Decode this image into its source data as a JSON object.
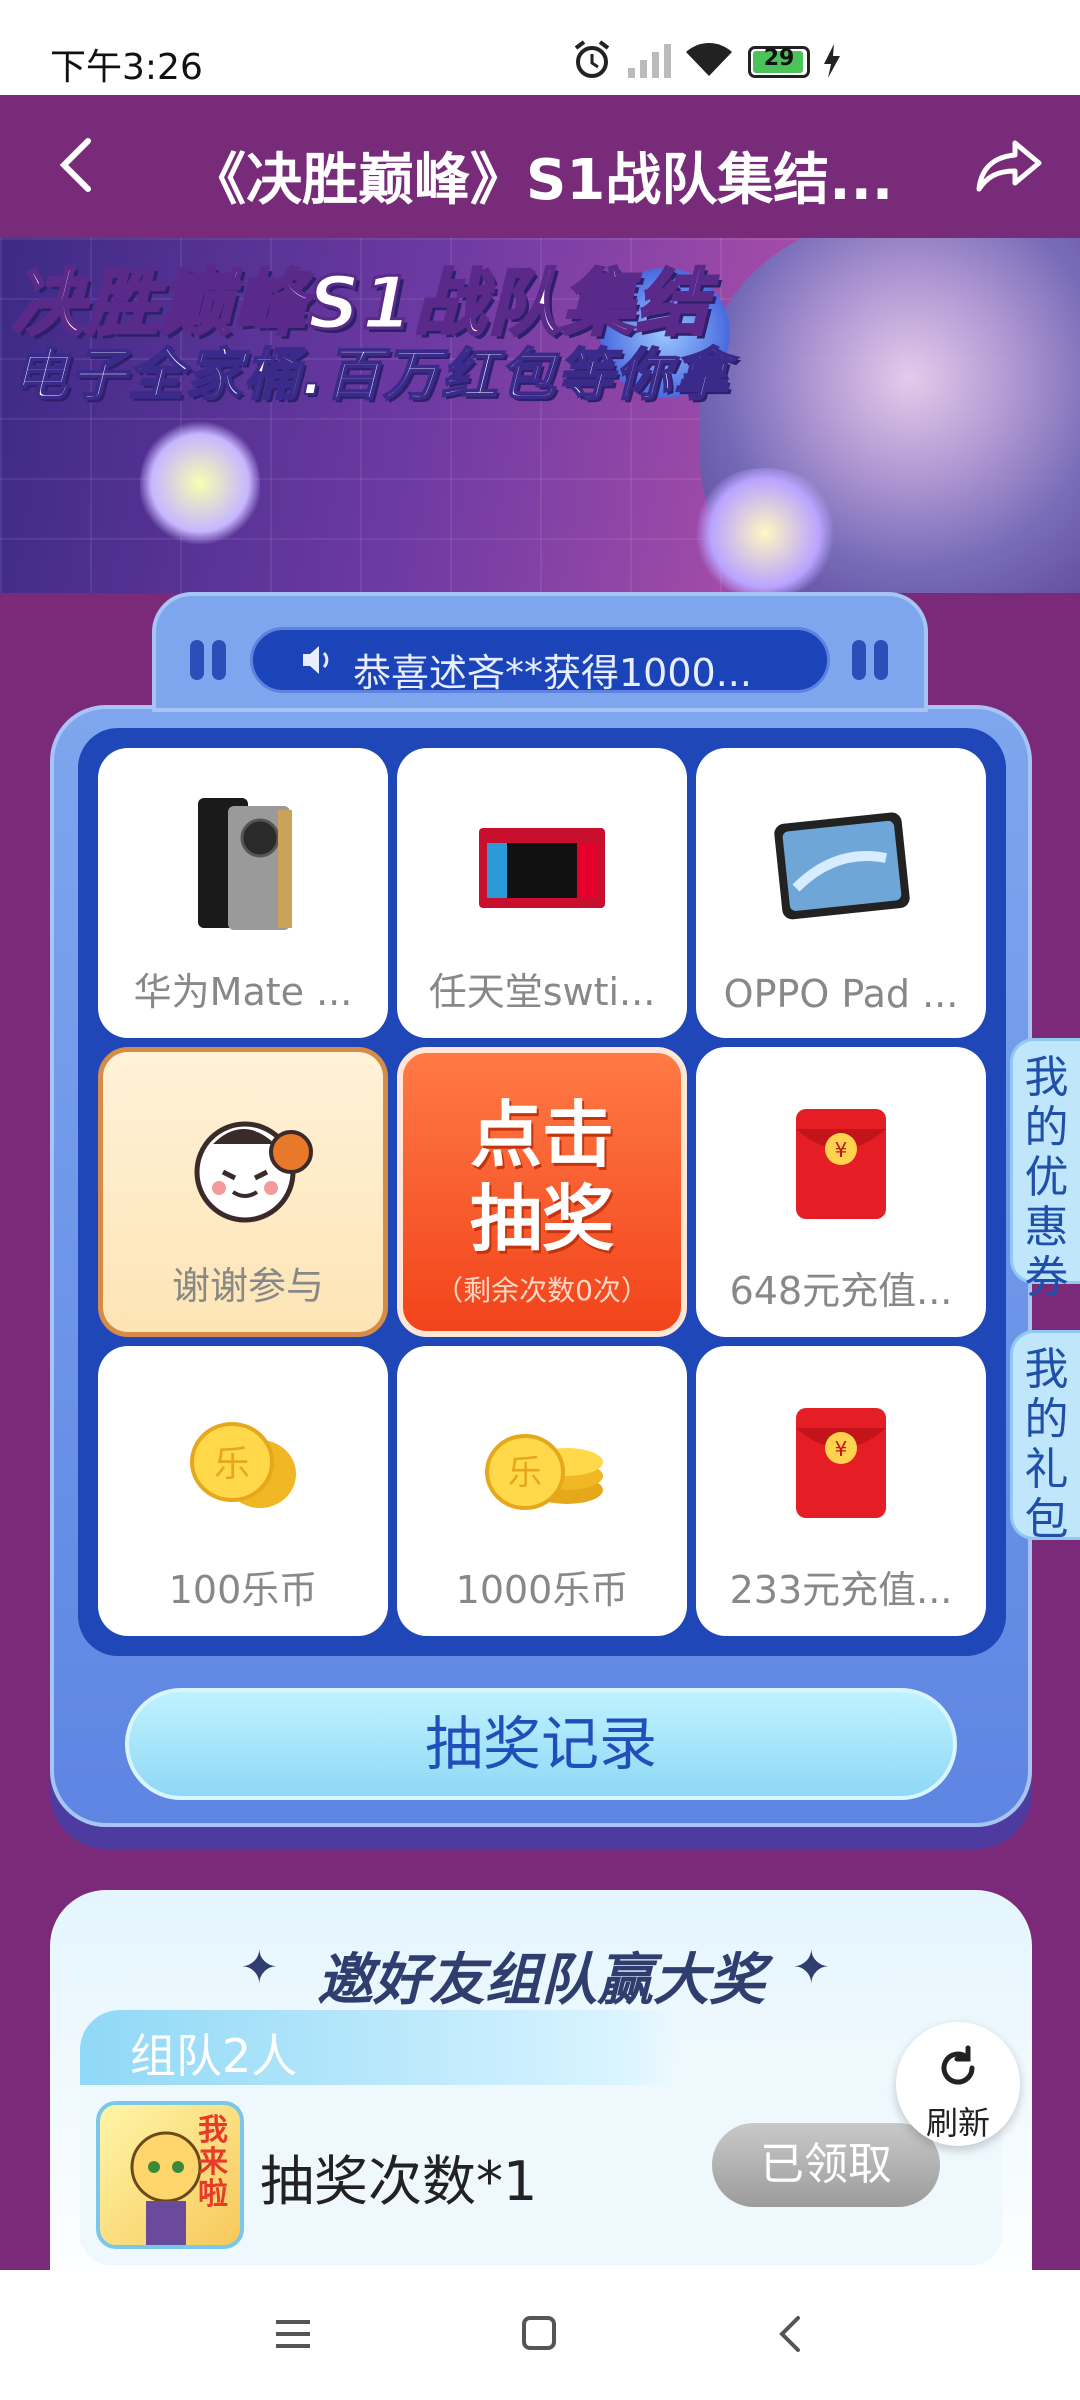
{
  "status_bar": {
    "time": "下午3:26",
    "battery_level": "29",
    "icons": [
      "alarm-icon",
      "signal-icon",
      "wifi-icon",
      "battery-icon",
      "charging-icon"
    ]
  },
  "header": {
    "title": "《决胜巅峰》S1战队集结..."
  },
  "banner": {
    "line1": "决胜巅峰S1战队集结",
    "line2": "电子全家桶.百万红包等你拿"
  },
  "lottery": {
    "marquee": "恭喜述吝**获得1000...",
    "prizes": [
      {
        "label": "华为Mate ...",
        "icon": "phone-icon"
      },
      {
        "label": "任天堂swti...",
        "icon": "game-console-icon"
      },
      {
        "label": "OPPO Pad ...",
        "icon": "tablet-icon"
      },
      {
        "label": "谢谢参与",
        "icon": "thanks-mascot-icon"
      },
      {
        "label": "648元充值...",
        "icon": "red-envelope-icon"
      },
      {
        "label": "100乐币",
        "icon": "coin-icon"
      },
      {
        "label": "1000乐币",
        "icon": "coin-stack-icon"
      },
      {
        "label": "233元充值...",
        "icon": "red-envelope-icon"
      }
    ],
    "draw_button": {
      "line1": "点击",
      "line2": "抽奖",
      "remaining": "（剩余次数0次）"
    },
    "record_button": "抽奖记录"
  },
  "side_tabs": {
    "coupons": "我的优惠券",
    "gifts": "我的礼包"
  },
  "team": {
    "heading": "邀好友组队赢大奖",
    "tier_label": "组队2人",
    "reward": "抽奖次数*1",
    "status_button": "已领取",
    "avatar_text": "我来啦"
  },
  "refresh": {
    "label": "刷新"
  },
  "colors": {
    "page_bg": "#7a2a78",
    "panel_blue": "#7ea6ee",
    "grid_blue": "#1f47b8",
    "draw_orange": "#f2431b",
    "record_text": "#1f4fb8"
  }
}
